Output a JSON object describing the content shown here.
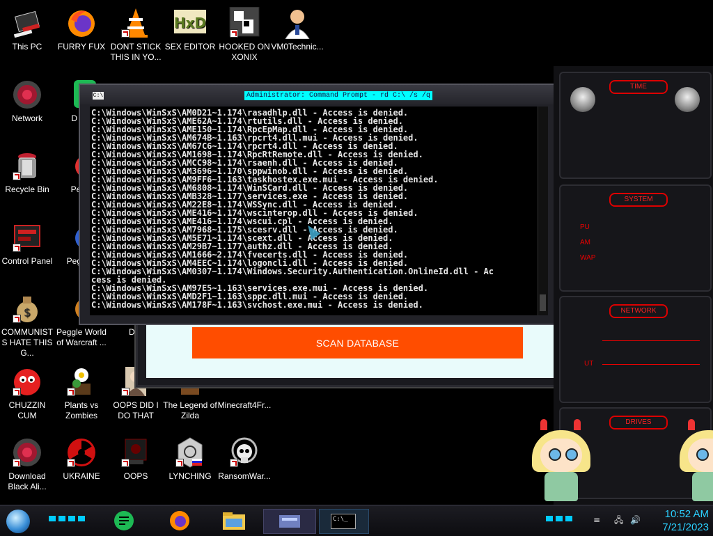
{
  "desktop": {
    "icons": [
      {
        "label": "This PC",
        "icon": "this-pc-icon"
      },
      {
        "label": "FURRY FUX",
        "icon": "firefox-icon"
      },
      {
        "label": "DONT STICK THIS IN YO...",
        "icon": "vlc-cone-icon"
      },
      {
        "label": "SEX EDITOR",
        "icon": "hex-editor-icon"
      },
      {
        "label": "HOOKED ON XONIX",
        "icon": "xonix-game-icon"
      },
      {
        "label": "VM0Technic...",
        "icon": "doctor-icon"
      },
      {
        "label": "Network",
        "icon": "alien-network-icon"
      },
      {
        "label": "D DU",
        "icon": "green-app-icon"
      },
      {
        "label": "Recycle Bin",
        "icon": "recycle-bin-icon"
      },
      {
        "label": "Peggl",
        "icon": "peggle-icon"
      },
      {
        "label": "Control Panel",
        "icon": "control-panel-icon"
      },
      {
        "label": "Peggl D",
        "icon": "peggle-icon"
      },
      {
        "label": "COMMUNISTS HATE THIS G...",
        "icon": "money-bag-icon"
      },
      {
        "label": "Peggle World of Warcraft ...",
        "icon": "peggle-icon"
      },
      {
        "label": "DIE",
        "icon": "die-icon"
      },
      {
        "label": "CHUZZIN CUM",
        "icon": "chuzzle-icon"
      },
      {
        "label": "Plants vs Zombies",
        "icon": "plants-zombies-icon"
      },
      {
        "label": "OOPS DID I DO THAT",
        "icon": "portrait-icon"
      },
      {
        "label": "The Legend of Zilda",
        "icon": "zelda-icon"
      },
      {
        "label": "Minecraft4Fr...",
        "icon": "minecraft-icon"
      },
      {
        "label": "Download Black Ali...",
        "icon": "alien-download-icon"
      },
      {
        "label": "UKRAINE",
        "icon": "radiation-icon"
      },
      {
        "label": "OOPS",
        "icon": "oops-icon"
      },
      {
        "label": "LYNCHING",
        "icon": "lynching-icon"
      },
      {
        "label": "RansomWar...",
        "icon": "skull-icon"
      }
    ]
  },
  "app_window": {
    "scan_label": "SCAN DATABASE",
    "accent": "#ff4d00",
    "panel_color": "#e9fbfb"
  },
  "cmd": {
    "title": "Administrator: Command Prompt - rd  C:\\ /s /q",
    "sys_icon_text": "C:\\",
    "lines": [
      "C:\\Windows\\WinSxS\\AM0D21~1.174\\rasadhlp.dll - Access is denied.",
      "C:\\Windows\\WinSxS\\AME62A~1.174\\rtutils.dll - Access is denied.",
      "C:\\Windows\\WinSxS\\AME150~1.174\\RpcEpMap.dll - Access is denied.",
      "C:\\Windows\\WinSxS\\AM674B~1.163\\rpcrt4.dll.mui - Access is denied.",
      "C:\\Windows\\WinSxS\\AM67C6~1.174\\rpcrt4.dll - Access is denied.",
      "C:\\Windows\\WinSxS\\AM1698~1.174\\RpcRtRemote.dll - Access is denied.",
      "C:\\Windows\\WinSxS\\AMCC98~1.174\\rsaenh.dll - Access is denied.",
      "C:\\Windows\\WinSxS\\AM3696~1.170\\sppwinob.dll - Access is denied.",
      "C:\\Windows\\WinSxS\\AM9FF6~1.163\\taskhostex.exe.mui - Access is denied.",
      "C:\\Windows\\WinSxS\\AM6808~1.174\\WinSCard.dll - Access is denied.",
      "C:\\Windows\\WinSxS\\AMB328~1.177\\services.exe - Access is denied.",
      "C:\\Windows\\WinSxS\\AM22E8~1.174\\WSSync.dll - Access is denied.",
      "C:\\Windows\\WinSxS\\AME416~1.174\\wscinterop.dll - Access is denied.",
      "C:\\Windows\\WinSxS\\AME416~1.174\\wscui.cpl - Access is denied.",
      "C:\\Windows\\WinSxS\\AM7968~1.175\\scesrv.dll - Access is denied.",
      "C:\\Windows\\WinSxS\\AM5E71~1.174\\scext.dll - Access is denied.",
      "C:\\Windows\\WinSxS\\AM29B7~1.177\\authz.dll - Access is denied.",
      "C:\\Windows\\WinSxS\\AM1666~2.174\\fvecerts.dll - Access is denied.",
      "C:\\Windows\\WinSxS\\AM4EEC~1.174\\logoncli.dll - Access is denied.",
      "C:\\Windows\\WinSxS\\AM0307~1.174\\Windows.Security.Authentication.OnlineId.dll - Ac",
      "cess is denied.",
      "C:\\Windows\\WinSxS\\AM97E5~1.163\\services.exe.mui - Access is denied.",
      "C:\\Windows\\WinSxS\\AMD2F1~1.163\\sppc.dll.mui - Access is denied.",
      "C:\\Windows\\WinSxS\\AM178F~1.163\\svchost.exe.mui - Access is denied."
    ]
  },
  "gadget": {
    "time_label": "TIME",
    "system_label": "SYSTEM",
    "network_label": "NETWORK",
    "drives_label": "DRIVES",
    "system_rows": [
      "PU",
      "AM",
      "WAP"
    ],
    "network_row": "UT",
    "accent": "#e00000"
  },
  "taskbar": {
    "apps": [
      "start-orb-icon",
      "notes-icon",
      "firefox-icon",
      "file-explorer-icon",
      "control-panel-icon",
      "command-prompt-icon"
    ],
    "cmd_icon_text": "C:\\_",
    "time": "10:52 AM",
    "date": "7/21/2023",
    "clock_color": "#2bd0ff"
  }
}
